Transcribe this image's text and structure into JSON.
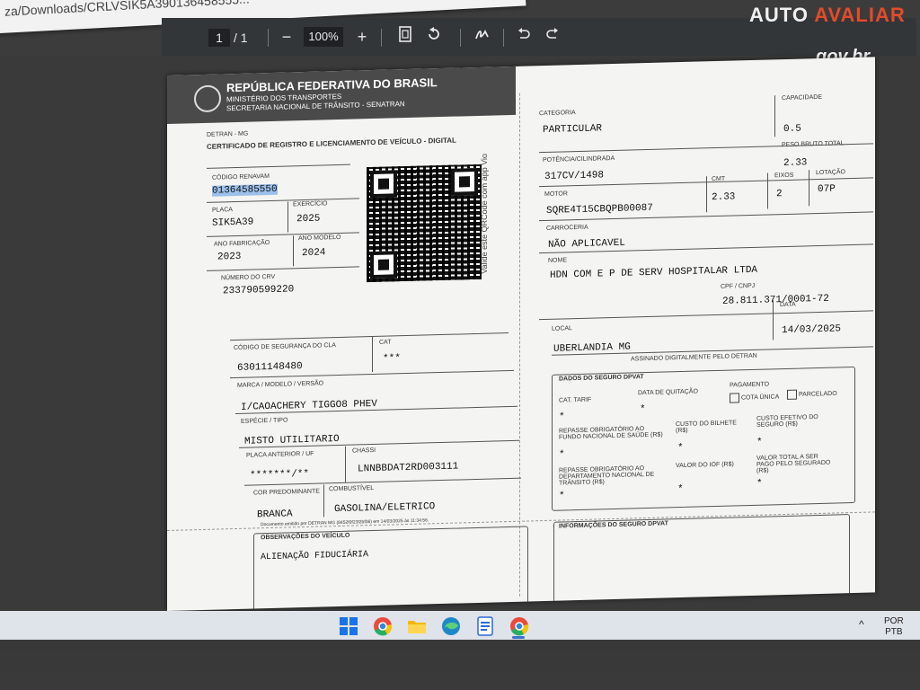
{
  "browser": {
    "address": "za/Downloads/CRLVSIK5A390136458555..."
  },
  "toolbar": {
    "page_current": "1",
    "page_sep": "/",
    "page_total": "1",
    "zoom_out": "−",
    "zoom": "100%",
    "zoom_in": "+"
  },
  "brand": {
    "part1": "AUTO ",
    "part2": "AVALIAR"
  },
  "govbr": "gov.br",
  "doc": {
    "title1": "REPÚBLICA FEDERATIVA DO BRASIL",
    "title2": "MINISTÉRIO DOS TRANSPORTES",
    "title3": "SECRETARIA NACIONAL DE TRÂNSITO - SENATRAN",
    "detran": "DETRAN - MG",
    "cert": "CERTIFICADO DE REGISTRO E LICENCIAMENTO DE VEÍCULO - DIGITAL",
    "qr_note": "Valide este QRCode com app Vio",
    "fields": {
      "renavam_lbl": "CÓDIGO RENAVAM",
      "renavam": "01364585550",
      "placa_lbl": "PLACA",
      "placa": "SIK5A39",
      "exercicio_lbl": "EXERCÍCIO",
      "exercicio": "2025",
      "ano_fab_lbl": "ANO FABRICAÇÃO",
      "ano_fab": "2023",
      "ano_mod_lbl": "ANO MODELO",
      "ano_mod": "2024",
      "crv_lbl": "NÚMERO DO CRV",
      "crv": "233790599220",
      "seg_lbl": "CÓDIGO DE SEGURANÇA DO CLA",
      "seg": "63011148480",
      "cat_lbl": "CAT",
      "cat": "***",
      "marca_lbl": "MARCA / MODELO / VERSÃO",
      "marca": "I/CAOACHERY TIGGO8 PHEV",
      "especie_lbl": "ESPÉCIE / TIPO",
      "especie": "MISTO UTILITARIO",
      "placa_ant_lbl": "PLACA ANTERIOR / UF",
      "placa_ant": "*******/**",
      "chassi_lbl": "CHASSI",
      "chassi": "LNNBBDAT2RD003111",
      "cor_lbl": "COR PREDOMINANTE",
      "cor": "BRANCA",
      "comb_lbl": "COMBUSTÍVEL",
      "comb": "GASOLINA/ELETRICO",
      "emitido": "Documento emitido por DETRAN MG (8452f0f23f2bf06) em 14/03/2025 às 11:34:56.",
      "obs_lbl": "OBSERVAÇÕES DO VEÍCULO",
      "obs": "ALIENAÇÃO FIDUCIÁRIA",
      "categoria_lbl": "CATEGORIA",
      "categoria": "PARTICULAR",
      "capacidade_lbl": "CAPACIDADE",
      "capacidade": "0.5",
      "potencia_lbl": "POTÊNCIA/CILINDRADA",
      "potencia": "317CV/1498",
      "peso_lbl": "PESO BRUTO TOTAL",
      "peso": "2.33",
      "motor_lbl": "MOTOR",
      "motor": "SQRE4T15CBQPB00087",
      "cmt_lbl": "CMT",
      "cmt": "2.33",
      "eixos_lbl": "EIXOS",
      "eixos": "2",
      "lotacao_lbl": "LOTAÇÃO",
      "lotacao": "07P",
      "carroceria_lbl": "CARROCERIA",
      "carroceria": "NÃO APLICAVEL",
      "nome_lbl": "NOME",
      "nome": "HDN COM E P DE SERV HOSPITALAR LTDA",
      "cpf_lbl": "CPF / CNPJ",
      "cpf": "28.811.371/0001-72",
      "local_lbl": "LOCAL",
      "local": "UBERLANDIA MG",
      "data_lbl": "DATA",
      "data": "14/03/2025",
      "assinado": "ASSINADO DIGITALMENTE PELO DETRAN"
    },
    "dpvat": {
      "title": "DADOS DO SEGURO DPVAT",
      "cat_tarif_lbl": "CAT. TARIF",
      "cat_tarif": "*",
      "data_quit_lbl": "DATA DE QUITAÇÃO",
      "data_quit": "*",
      "pagamento_lbl": "PAGAMENTO",
      "cota_unica": "COTA ÚNICA",
      "parcelado": "PARCELADO",
      "repasse_fns_lbl": "REPASSE OBRIGATÓRIO AO FUNDO NACIONAL DE SAÚDE (R$)",
      "repasse_fns": "*",
      "custo_bilhete_lbl": "CUSTO DO BILHETE (R$)",
      "custo_bilhete": "*",
      "custo_efetivo_lbl": "CUSTO EFETIVO DO SEGURO (R$)",
      "custo_efetivo": "*",
      "repasse_dnt_lbl": "REPASSE OBRIGATÓRIO AO DEPARTAMENTO NACIONAL DE TRÂNSITO (R$)",
      "repasse_dnt": "*",
      "iof_lbl": "VALOR DO IOF (R$)",
      "iof": "*",
      "total_lbl": "VALOR TOTAL A SER PAGO PELO SEGURADO (R$)",
      "total": "*",
      "info_lbl": "INFORMAÇÕES DO SEGURO DPVAT"
    }
  },
  "tray": {
    "lang1": "POR",
    "lang2": "PTB",
    "caret": "^"
  }
}
